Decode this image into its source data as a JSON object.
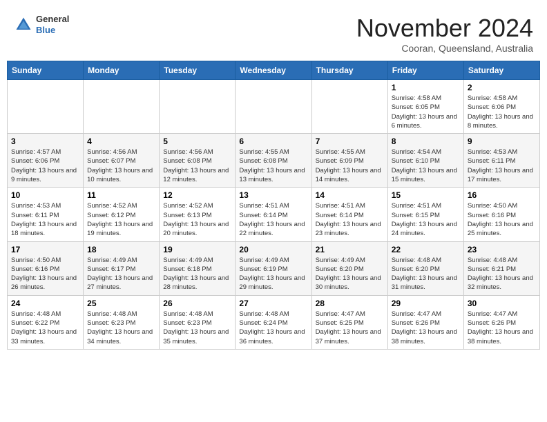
{
  "header": {
    "logo_general": "General",
    "logo_blue": "Blue",
    "month_title": "November 2024",
    "location": "Cooran, Queensland, Australia"
  },
  "days_of_week": [
    "Sunday",
    "Monday",
    "Tuesday",
    "Wednesday",
    "Thursday",
    "Friday",
    "Saturday"
  ],
  "weeks": [
    [
      {
        "day": "",
        "info": ""
      },
      {
        "day": "",
        "info": ""
      },
      {
        "day": "",
        "info": ""
      },
      {
        "day": "",
        "info": ""
      },
      {
        "day": "",
        "info": ""
      },
      {
        "day": "1",
        "info": "Sunrise: 4:58 AM\nSunset: 6:05 PM\nDaylight: 13 hours and 6 minutes."
      },
      {
        "day": "2",
        "info": "Sunrise: 4:58 AM\nSunset: 6:06 PM\nDaylight: 13 hours and 8 minutes."
      }
    ],
    [
      {
        "day": "3",
        "info": "Sunrise: 4:57 AM\nSunset: 6:06 PM\nDaylight: 13 hours and 9 minutes."
      },
      {
        "day": "4",
        "info": "Sunrise: 4:56 AM\nSunset: 6:07 PM\nDaylight: 13 hours and 10 minutes."
      },
      {
        "day": "5",
        "info": "Sunrise: 4:56 AM\nSunset: 6:08 PM\nDaylight: 13 hours and 12 minutes."
      },
      {
        "day": "6",
        "info": "Sunrise: 4:55 AM\nSunset: 6:08 PM\nDaylight: 13 hours and 13 minutes."
      },
      {
        "day": "7",
        "info": "Sunrise: 4:55 AM\nSunset: 6:09 PM\nDaylight: 13 hours and 14 minutes."
      },
      {
        "day": "8",
        "info": "Sunrise: 4:54 AM\nSunset: 6:10 PM\nDaylight: 13 hours and 15 minutes."
      },
      {
        "day": "9",
        "info": "Sunrise: 4:53 AM\nSunset: 6:11 PM\nDaylight: 13 hours and 17 minutes."
      }
    ],
    [
      {
        "day": "10",
        "info": "Sunrise: 4:53 AM\nSunset: 6:11 PM\nDaylight: 13 hours and 18 minutes."
      },
      {
        "day": "11",
        "info": "Sunrise: 4:52 AM\nSunset: 6:12 PM\nDaylight: 13 hours and 19 minutes."
      },
      {
        "day": "12",
        "info": "Sunrise: 4:52 AM\nSunset: 6:13 PM\nDaylight: 13 hours and 20 minutes."
      },
      {
        "day": "13",
        "info": "Sunrise: 4:51 AM\nSunset: 6:14 PM\nDaylight: 13 hours and 22 minutes."
      },
      {
        "day": "14",
        "info": "Sunrise: 4:51 AM\nSunset: 6:14 PM\nDaylight: 13 hours and 23 minutes."
      },
      {
        "day": "15",
        "info": "Sunrise: 4:51 AM\nSunset: 6:15 PM\nDaylight: 13 hours and 24 minutes."
      },
      {
        "day": "16",
        "info": "Sunrise: 4:50 AM\nSunset: 6:16 PM\nDaylight: 13 hours and 25 minutes."
      }
    ],
    [
      {
        "day": "17",
        "info": "Sunrise: 4:50 AM\nSunset: 6:16 PM\nDaylight: 13 hours and 26 minutes."
      },
      {
        "day": "18",
        "info": "Sunrise: 4:49 AM\nSunset: 6:17 PM\nDaylight: 13 hours and 27 minutes."
      },
      {
        "day": "19",
        "info": "Sunrise: 4:49 AM\nSunset: 6:18 PM\nDaylight: 13 hours and 28 minutes."
      },
      {
        "day": "20",
        "info": "Sunrise: 4:49 AM\nSunset: 6:19 PM\nDaylight: 13 hours and 29 minutes."
      },
      {
        "day": "21",
        "info": "Sunrise: 4:49 AM\nSunset: 6:20 PM\nDaylight: 13 hours and 30 minutes."
      },
      {
        "day": "22",
        "info": "Sunrise: 4:48 AM\nSunset: 6:20 PM\nDaylight: 13 hours and 31 minutes."
      },
      {
        "day": "23",
        "info": "Sunrise: 4:48 AM\nSunset: 6:21 PM\nDaylight: 13 hours and 32 minutes."
      }
    ],
    [
      {
        "day": "24",
        "info": "Sunrise: 4:48 AM\nSunset: 6:22 PM\nDaylight: 13 hours and 33 minutes."
      },
      {
        "day": "25",
        "info": "Sunrise: 4:48 AM\nSunset: 6:23 PM\nDaylight: 13 hours and 34 minutes."
      },
      {
        "day": "26",
        "info": "Sunrise: 4:48 AM\nSunset: 6:23 PM\nDaylight: 13 hours and 35 minutes."
      },
      {
        "day": "27",
        "info": "Sunrise: 4:48 AM\nSunset: 6:24 PM\nDaylight: 13 hours and 36 minutes."
      },
      {
        "day": "28",
        "info": "Sunrise: 4:47 AM\nSunset: 6:25 PM\nDaylight: 13 hours and 37 minutes."
      },
      {
        "day": "29",
        "info": "Sunrise: 4:47 AM\nSunset: 6:26 PM\nDaylight: 13 hours and 38 minutes."
      },
      {
        "day": "30",
        "info": "Sunrise: 4:47 AM\nSunset: 6:26 PM\nDaylight: 13 hours and 38 minutes."
      }
    ]
  ]
}
